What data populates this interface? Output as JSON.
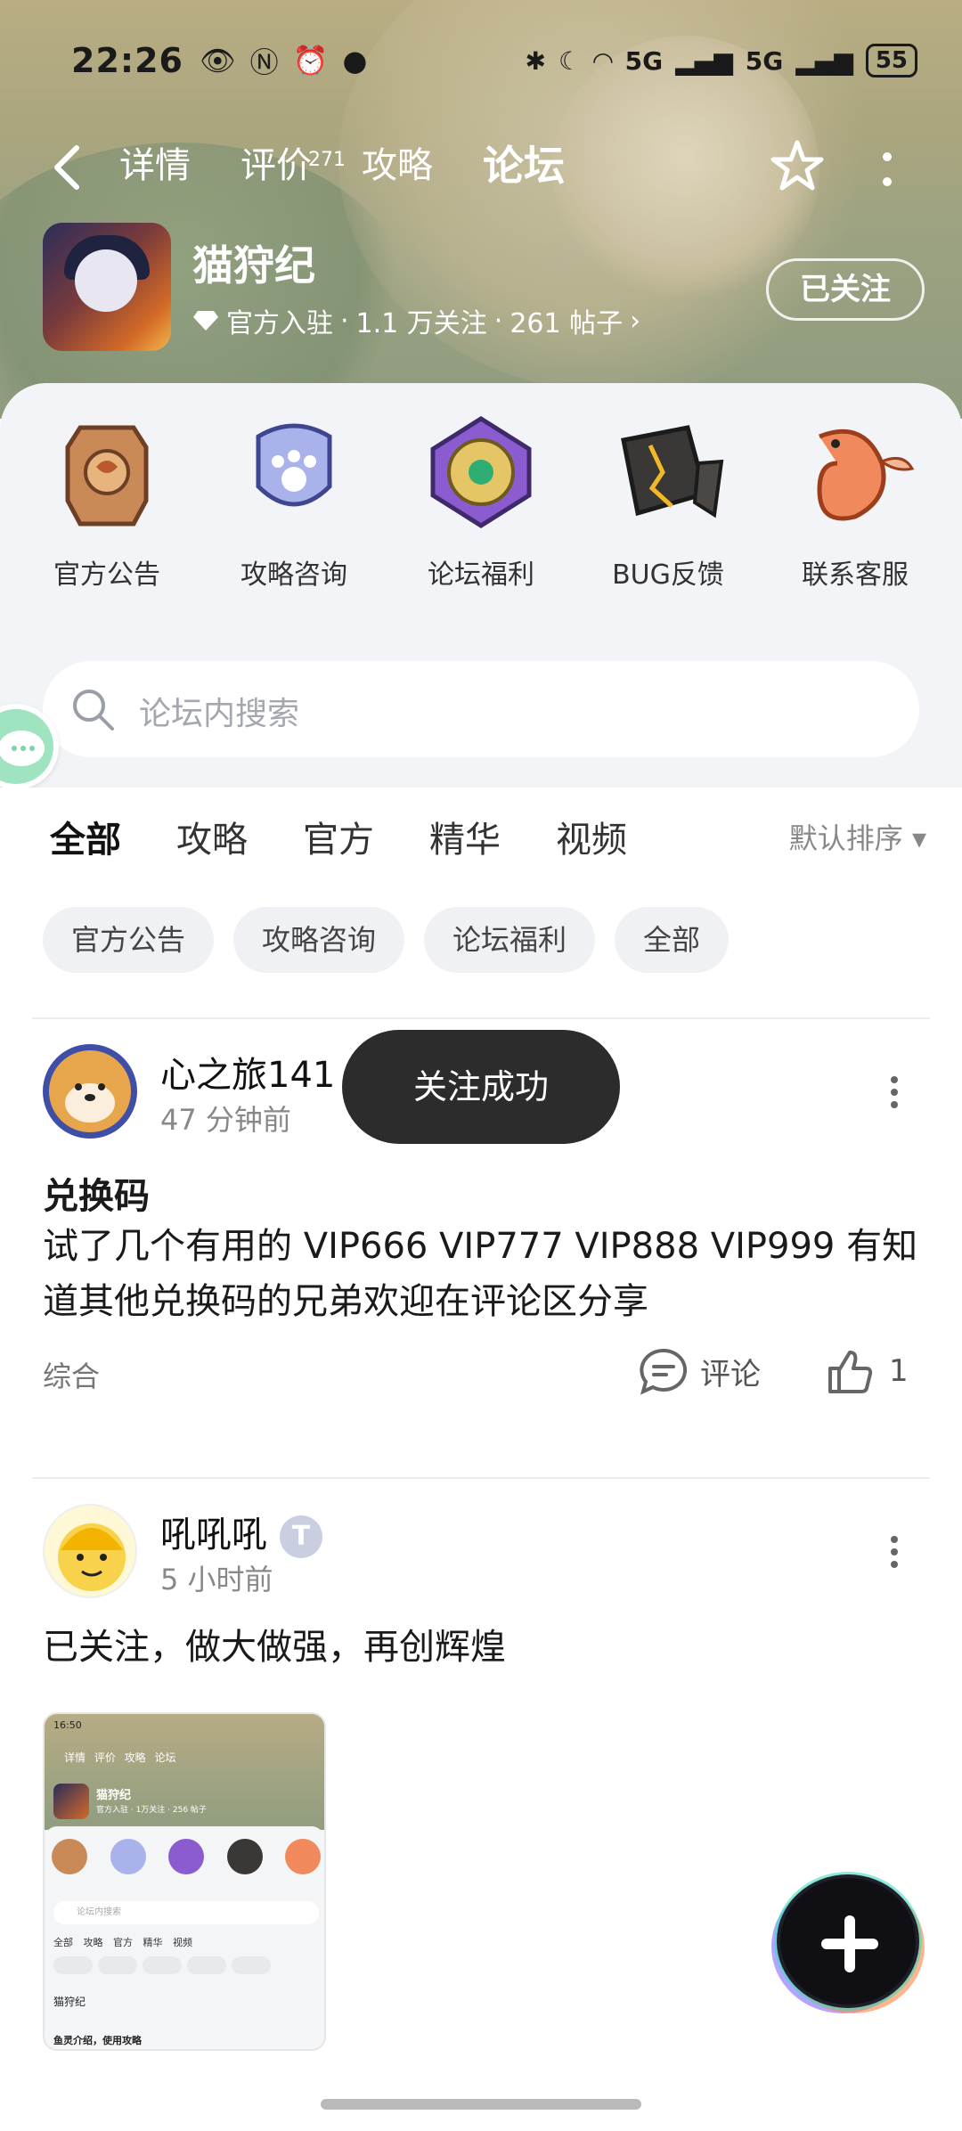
{
  "status_bar": {
    "time": "22:26",
    "network": "5G",
    "battery": "55"
  },
  "nav": {
    "tabs": [
      {
        "label": "详情"
      },
      {
        "label": "评价",
        "badge": "271"
      },
      {
        "label": "攻略"
      },
      {
        "label": "论坛",
        "active": true
      }
    ],
    "icons": [
      "back-icon",
      "star-icon",
      "more-icon"
    ]
  },
  "game": {
    "title": "猫狩纪",
    "official_label": "官方入驻",
    "followers": "1.1 万关注",
    "posts": "261 帖子",
    "follow_button": "已关注"
  },
  "quick_links": [
    {
      "label": "官方公告",
      "icon": "notice-plaque-icon"
    },
    {
      "label": "攻略咨询",
      "icon": "paw-badge-icon"
    },
    {
      "label": "论坛福利",
      "icon": "gem-amulet-icon"
    },
    {
      "label": "BUG反馈",
      "icon": "cracked-stone-icon"
    },
    {
      "label": "联系客服",
      "icon": "koi-fish-icon"
    }
  ],
  "search": {
    "placeholder": "论坛内搜索"
  },
  "filter": {
    "tabs": [
      "全部",
      "攻略",
      "官方",
      "精华",
      "视频"
    ],
    "active": "全部",
    "sort_label": "默认排序"
  },
  "chips": [
    "官方公告",
    "攻略咨询",
    "论坛福利",
    "全部"
  ],
  "posts": [
    {
      "author": "心之旅141",
      "time": "47 分钟前",
      "title": "兑换码",
      "body": "试了几个有用的 VIP666 VIP777 VIP888 VIP999 有知道其他兑换码的兄弟欢迎在评论区分享",
      "tag": "综合",
      "comment_label": "评论",
      "likes": "1"
    },
    {
      "author": "吼吼吼",
      "level_badge": "T",
      "time": "5 小时前",
      "body": "已关注，做大做强，再创辉煌",
      "thumbnail": {
        "time": "16:50",
        "tabs": "详情 评价 攻略 论坛",
        "title": "猫狩纪",
        "meta": "官方入驻 · 1万关注 · 256 帖子",
        "search": "论坛内搜索",
        "filter_tabs": "全部 攻略 官方 精华 视频",
        "post_author": "猫狩纪",
        "post_title": "鱼灵介绍，使用攻略"
      }
    }
  ],
  "toast": "关注成功",
  "colors": {
    "accent": "#3ed7c3",
    "toast_bg": "#2c2c2c",
    "panel_bg": "#f3f4f7"
  }
}
